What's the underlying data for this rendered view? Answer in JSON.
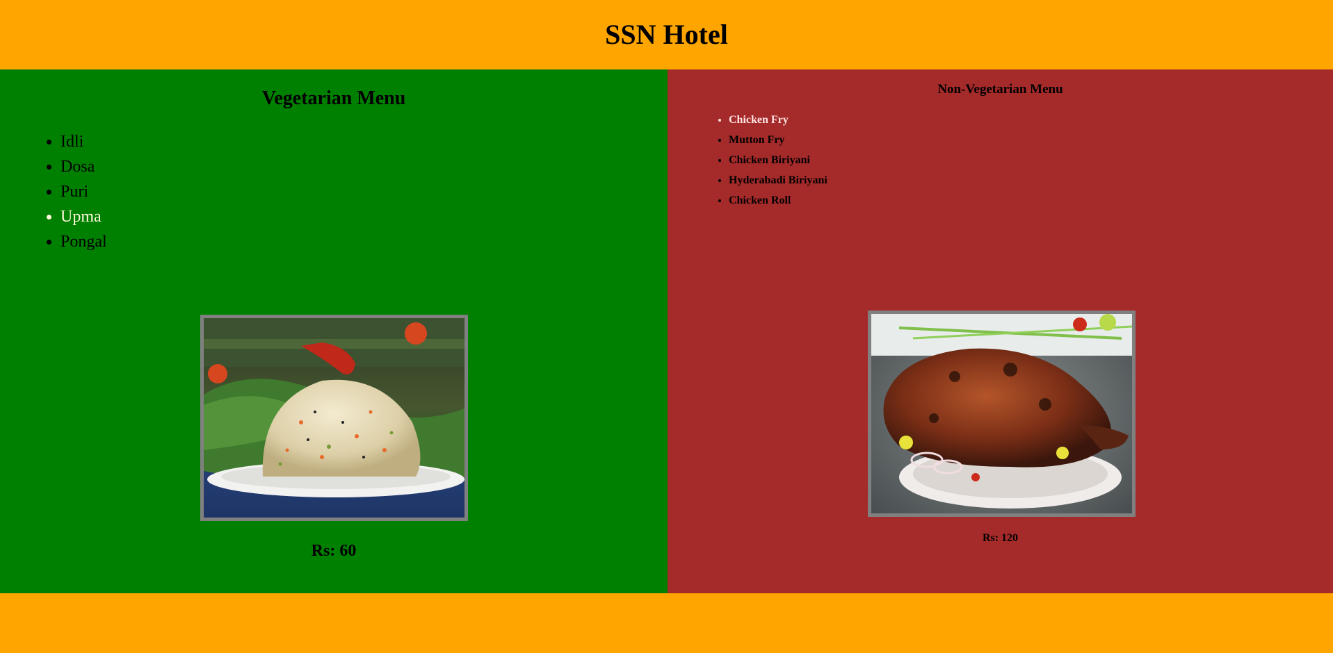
{
  "header": {
    "title": "SSN Hotel"
  },
  "veg_menu": {
    "heading": "Vegetarian Menu",
    "items": [
      "Idli",
      "Dosa",
      "Puri",
      "Upma",
      "Pongal"
    ],
    "highlighted_item": "Upma",
    "image_alt": "Upma dish",
    "price": "Rs: 60"
  },
  "nonveg_menu": {
    "heading": "Non-Vegetarian Menu",
    "items": [
      "Chicken Fry",
      "Mutton Fry",
      "Chicken Biriyani",
      "Hyderabadi Biriyani",
      "Chicken Roll"
    ],
    "highlighted_item": "Chicken Fry",
    "image_alt": "Chicken fry dish",
    "price": "Rs: 120"
  },
  "colors": {
    "header_bg": "#ffa500",
    "veg_bg": "#008000",
    "nonveg_bg": "#a52a2a",
    "footer_bg": "#ffa500",
    "image_border": "#808080"
  }
}
